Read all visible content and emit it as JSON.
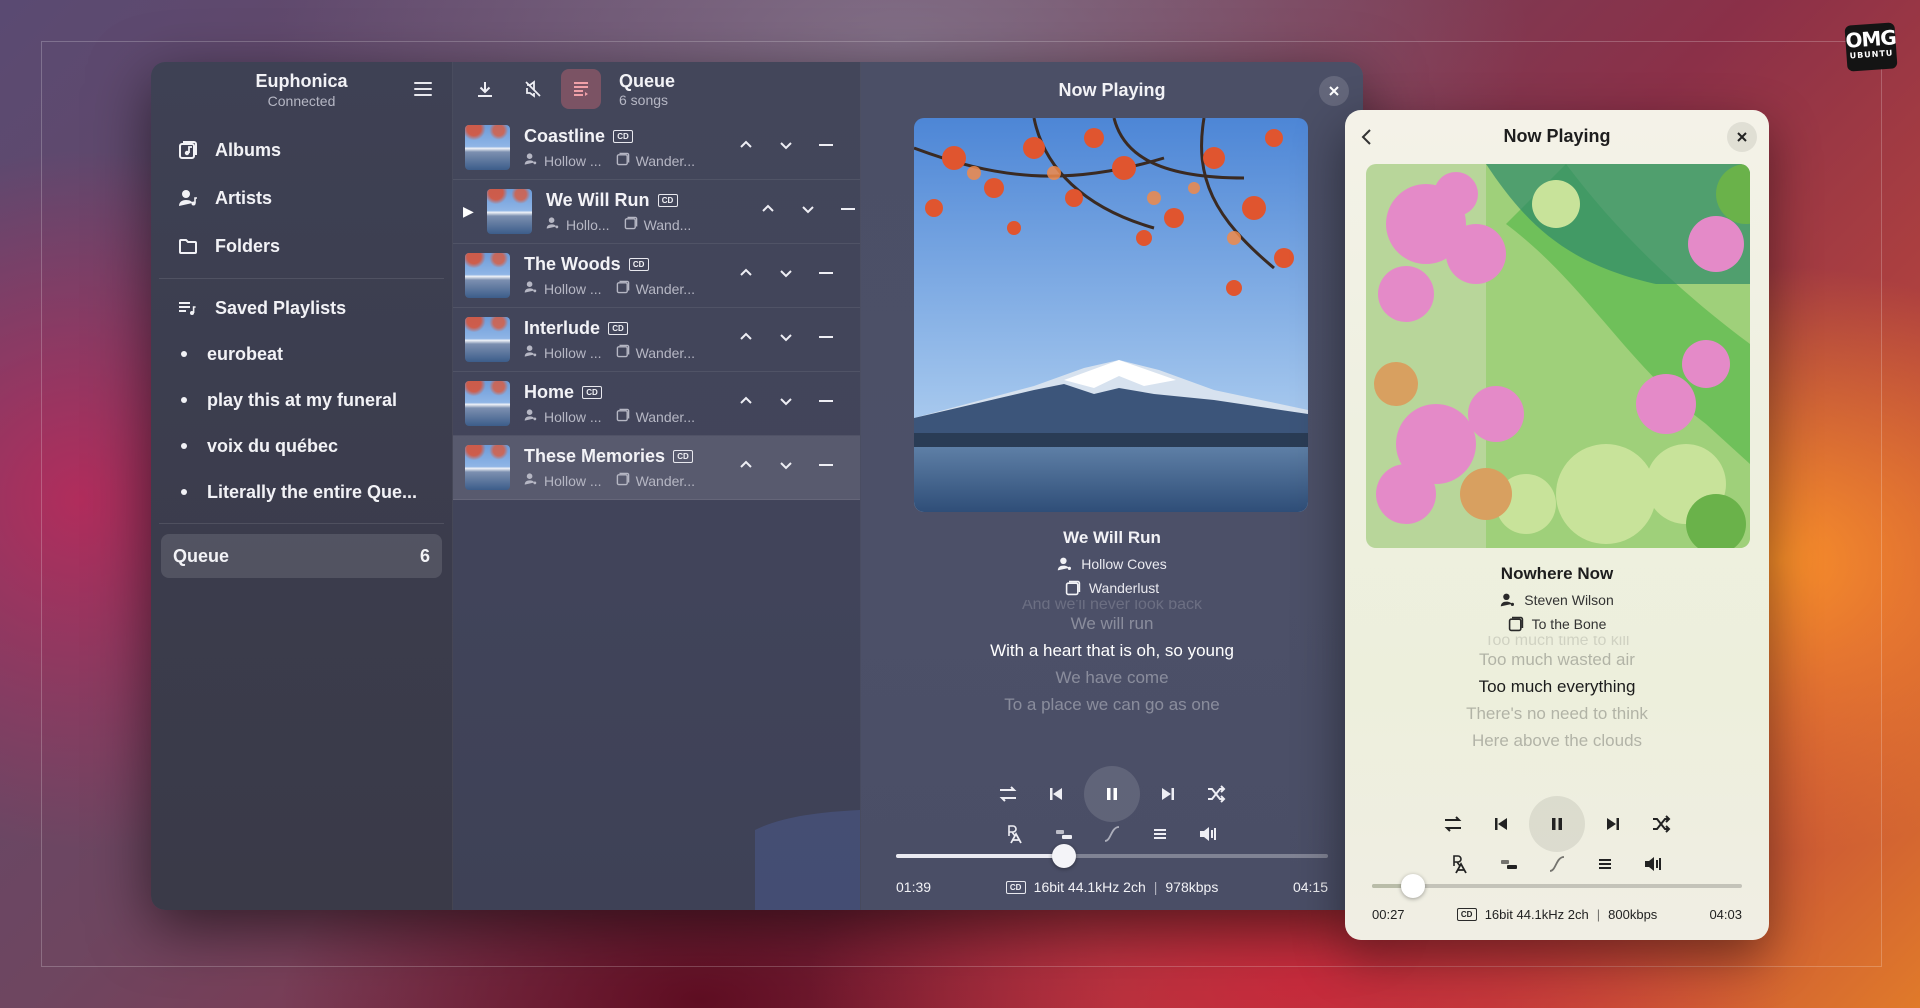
{
  "app": {
    "title": "Euphonica",
    "status": "Connected"
  },
  "sidebar": {
    "nav": [
      {
        "label": "Albums",
        "icon": "album-icon"
      },
      {
        "label": "Artists",
        "icon": "artist-icon"
      },
      {
        "label": "Folders",
        "icon": "folder-icon"
      }
    ],
    "playlists_header": "Saved Playlists",
    "playlists": [
      "eurobeat",
      "play this at my funeral",
      "voix du québec",
      "Literally the entire Que..."
    ],
    "queue_label": "Queue",
    "queue_count": "6"
  },
  "queue": {
    "title": "Queue",
    "subtitle": "6 songs",
    "badge": "CD",
    "rows": [
      {
        "song": "Coastline",
        "artist": "Hollow ...",
        "album": "Wander..."
      },
      {
        "song": "We Will Run",
        "artist": "Hollo...",
        "album": "Wand..."
      },
      {
        "song": "The Woods",
        "artist": "Hollow ...",
        "album": "Wander..."
      },
      {
        "song": "Interlude",
        "artist": "Hollow ...",
        "album": "Wander..."
      },
      {
        "song": "Home",
        "artist": "Hollow ...",
        "album": "Wander..."
      },
      {
        "song": "These Memories",
        "artist": "Hollow ...",
        "album": "Wander..."
      }
    ]
  },
  "now_playing": {
    "header": "Now Playing",
    "song": "We Will Run",
    "artist": "Hollow Coves",
    "album": "Wanderlust",
    "lyrics": {
      "prev2": "And we'll never look back",
      "prev1": "We will run",
      "current": "With a heart that is oh, so young",
      "next1": "We have come",
      "next2": "To a place we can go as one"
    },
    "position": "01:39",
    "duration": "04:15",
    "progress": 0.39,
    "badge": "CD",
    "format": "16bit 44.1kHz 2ch",
    "bitrate": "978kbps"
  },
  "mini_player": {
    "header": "Now Playing",
    "song": "Nowhere Now",
    "artist": "Steven Wilson",
    "album": "To the Bone",
    "lyrics": {
      "prev2": "Too much time to kill",
      "prev1": "Too much wasted air",
      "current": "Too much everything",
      "next1": "There's no need to think",
      "next2": "Here above the clouds"
    },
    "position": "00:27",
    "duration": "04:03",
    "progress": 0.11,
    "badge": "CD",
    "format": "16bit 44.1kHz 2ch",
    "bitrate": "800kbps"
  },
  "watermark": {
    "line1": "OMG",
    "line2": "UBUNTU"
  }
}
